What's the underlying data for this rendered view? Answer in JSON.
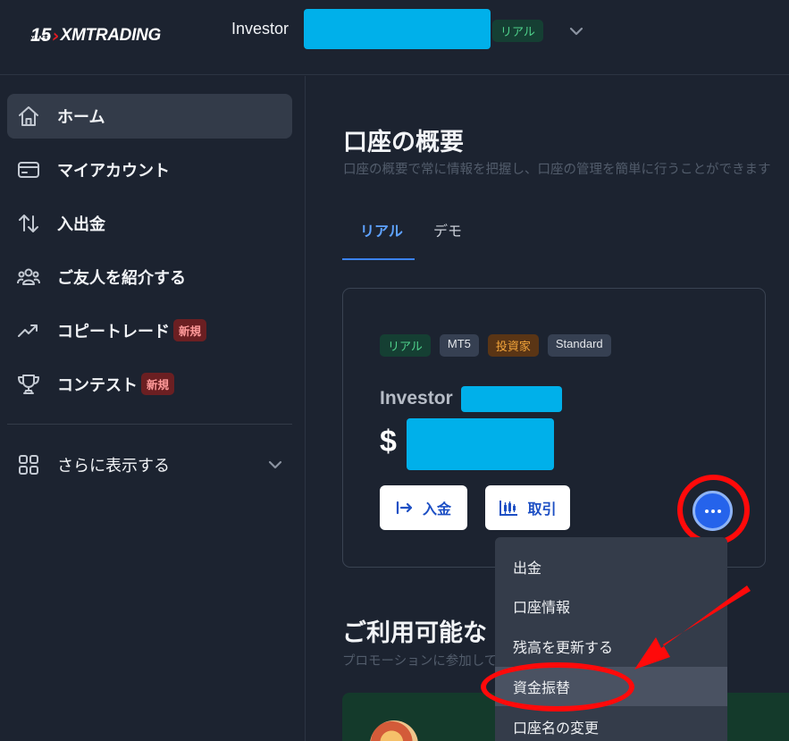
{
  "header": {
    "logo_years": "15",
    "logo_years_sub": "YEARS",
    "logo_brand": "XMTRADING",
    "account_label": "Investor",
    "account_type_badge": "リアル"
  },
  "sidebar": {
    "items": [
      {
        "label": "ホーム",
        "icon": "home-icon",
        "active": true
      },
      {
        "label": "マイアカウント",
        "icon": "card-icon",
        "active": false
      },
      {
        "label": "入出金",
        "icon": "transfer-arrows-icon",
        "active": false
      },
      {
        "label": "ご友人を紹介する",
        "icon": "users-icon",
        "active": false
      },
      {
        "label": "コピートレード",
        "icon": "trending-up-icon",
        "active": false,
        "badge": "新規"
      },
      {
        "label": "コンテスト",
        "icon": "trophy-icon",
        "active": false,
        "badge": "新規"
      }
    ],
    "more_label": "さらに表示する"
  },
  "main": {
    "title": "口座の概要",
    "subtitle": "口座の概要で常に情報を把握し、口座の管理を簡単に行うことができます",
    "tabs": [
      {
        "label": "リアル",
        "active": true
      },
      {
        "label": "デモ",
        "active": false
      }
    ],
    "account_card": {
      "badges": [
        "リアル",
        "MT5",
        "投資家",
        "Standard"
      ],
      "name": "Investor",
      "currency_symbol": "$",
      "deposit_button": "入金",
      "trade_button": "取引"
    },
    "section_title": "ご利用可能な",
    "section_subtitle": "プロモーションに参加して豪"
  },
  "dropdown_menu": {
    "items": [
      "出金",
      "口座情報",
      "残高を更新する",
      "資金振替",
      "口座名の変更"
    ],
    "highlighted": "資金振替"
  },
  "colors": {
    "background": "#1c2330",
    "accent_blue": "#2563eb",
    "annotation_red": "#ff0a0a",
    "redaction": "#00b0ea"
  }
}
